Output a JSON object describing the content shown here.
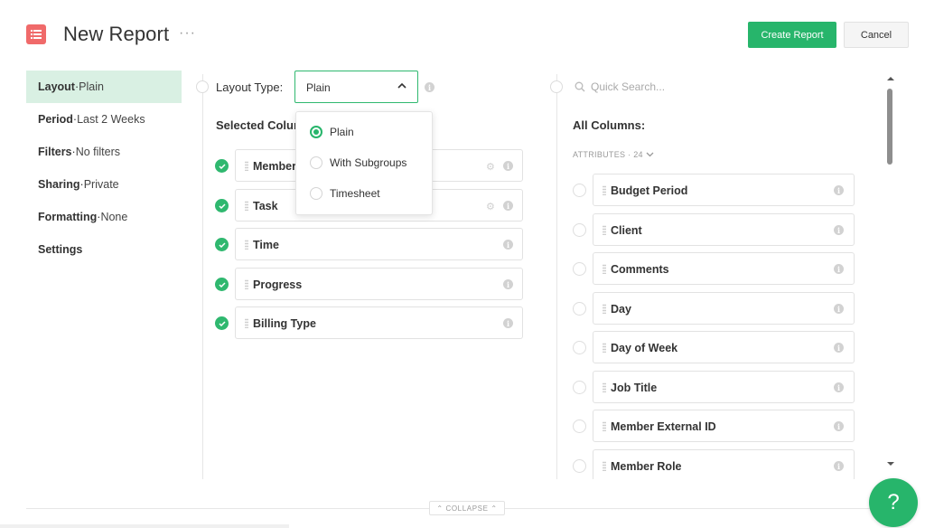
{
  "header": {
    "title": "New Report",
    "more_label": "···",
    "create_label": "Create Report",
    "cancel_label": "Cancel"
  },
  "sidebar": {
    "items": [
      {
        "key": "Layout",
        "value": "Plain"
      },
      {
        "key": "Period",
        "value": "Last 2 Weeks"
      },
      {
        "key": "Filters",
        "value": "No filters"
      },
      {
        "key": "Sharing",
        "value": "Private"
      },
      {
        "key": "Formatting",
        "value": "None"
      },
      {
        "key": "Settings",
        "value": ""
      }
    ],
    "separator": " · "
  },
  "layout": {
    "label": "Layout Type:",
    "selected": "Plain",
    "options": [
      "Plain",
      "With Subgroups",
      "Timesheet"
    ]
  },
  "selected_columns": {
    "title": "Selected Colum",
    "items": [
      "Member",
      "Task",
      "Time",
      "Progress",
      "Billing Type"
    ]
  },
  "all_columns": {
    "search_placeholder": "Quick Search...",
    "title": "All Columns:",
    "group_label": "ATTRIBUTES · 24",
    "items": [
      "Budget Period",
      "Client",
      "Comments",
      "Day",
      "Day of Week",
      "Job Title",
      "Member External ID",
      "Member Role"
    ]
  },
  "footer": {
    "collapse_label": "⌃ COLLAPSE ⌃",
    "help_label": "?"
  },
  "colors": {
    "accent": "#27b56b",
    "active_nav": "#d9f0e3",
    "app_icon": "#f06a6a"
  }
}
